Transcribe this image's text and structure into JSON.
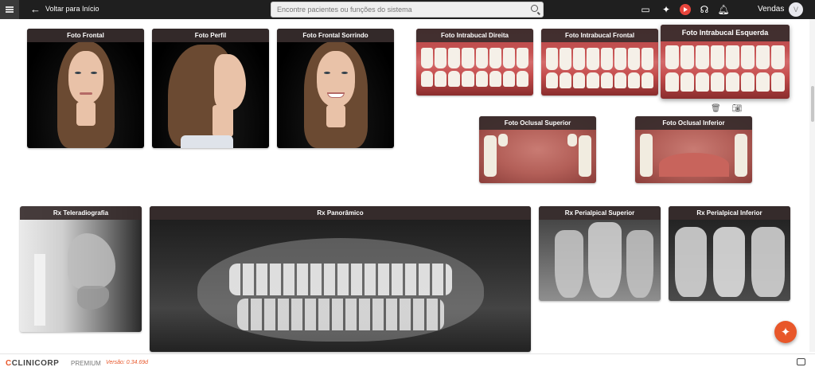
{
  "header": {
    "back_label": "Voltar para Início",
    "search_placeholder": "Encontre pacientes ou funções do sistema",
    "user_name": "Vendas",
    "avatar_initial": "V"
  },
  "photos": {
    "frontal": "Foto Frontal",
    "perfil": "Foto Perfil",
    "frontal_sorrindo": "Foto Frontal Sorrindo",
    "intrabucal_direita": "Foto Intrabucal Direita",
    "intrabucal_frontal": "Foto Intrabucal Frontal",
    "intrabucal_esquerda": "Foto Intrabucal Esquerda",
    "oclusal_superior": "Foto Oclusal Superior",
    "oclusal_inferior": "Foto Oclusal Inferior"
  },
  "xrays": {
    "teleradiografia": "Rx Teleradiografia",
    "panoramico": "Rx Panorâmico",
    "periapical_superior": "Rx Perialpical Superior",
    "periapical_inferior": "Rx Perialpical Inferior"
  },
  "footer": {
    "brand_mark": "C",
    "brand_name": "CLINICORP",
    "plan": "PREMIUM",
    "version": "Versão: 0.34.69d"
  },
  "colors": {
    "accent": "#e8572a",
    "topbar": "#1f1f1f"
  }
}
